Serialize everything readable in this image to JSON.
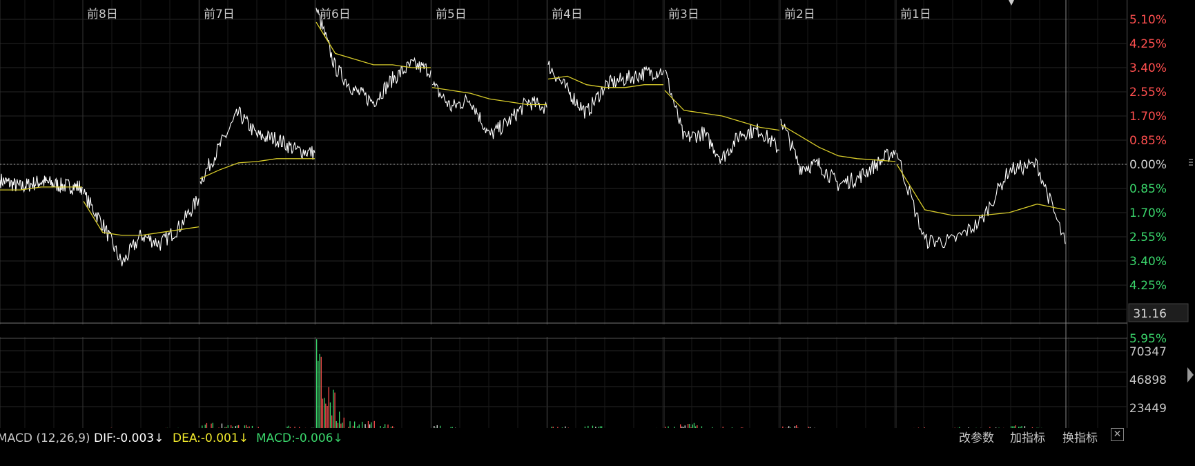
{
  "colors": {
    "background": "#000000",
    "grid": "#262626",
    "price_line": "#ffffff",
    "avg_line": "#d8cc2a",
    "up": "#ff4f4f",
    "down": "#3ad56b",
    "neutral": "#e6e6e6"
  },
  "chart_data": [
    {
      "type": "line",
      "unit": "percent change",
      "categories": [
        "前8日",
        "前7日",
        "前6日",
        "前5日",
        "前4日",
        "前3日",
        "前2日",
        "前1日"
      ],
      "y_axis_labels": [
        "5.95%",
        "5.10%",
        "4.25%",
        "3.40%",
        "2.55%",
        "1.70%",
        "0.85%",
        "0.00%",
        "0.85%",
        "1.70%",
        "2.55%",
        "3.40%",
        "4.25%"
      ],
      "ylim": [
        -4.9,
        5.95
      ],
      "grid": true,
      "current_value": "31.16",
      "bottom_cut_label": "5.95%",
      "series": [
        {
          "values": [
            [
              -0.55,
              -0.8,
              -0.6,
              -0.75,
              -0.8
            ],
            [
              -1.05,
              -2.1,
              -3.5,
              -2.5,
              -2.8,
              -2.2,
              -1.2
            ],
            [
              -0.6,
              0.6,
              1.8,
              1.0,
              0.9,
              0.5,
              0.4
            ],
            [
              5.5,
              3.4,
              2.6,
              2.2,
              3.0,
              3.5,
              3.3
            ],
            [
              2.8,
              2.0,
              2.3,
              1.0,
              1.5,
              2.2,
              2.0
            ],
            [
              3.5,
              2.6,
              1.8,
              2.8,
              3.0,
              3.2,
              3.3
            ],
            [
              3.3,
              0.9,
              1.1,
              0.2,
              1.1,
              1.2,
              0.5
            ],
            [
              1.6,
              -0.1,
              0.0,
              -0.7,
              -0.5,
              0.0,
              0.5
            ],
            [
              0.4,
              -2.7,
              -2.7,
              -2.0,
              -0.2,
              0.0,
              -2.8
            ]
          ]
        },
        {
          "values": [
            [
              -0.9,
              -0.9,
              -0.8,
              -0.8,
              -0.8
            ],
            [
              -1.3,
              -2.4,
              -2.5,
              -2.5,
              -2.4,
              -2.3,
              -2.2
            ],
            [
              -0.5,
              -0.2,
              0.05,
              0.1,
              0.2,
              0.2,
              0.2
            ],
            [
              5.0,
              3.9,
              3.7,
              3.5,
              3.5,
              3.4,
              3.4
            ],
            [
              2.7,
              2.6,
              2.5,
              2.3,
              2.2,
              2.1,
              2.1
            ],
            [
              3.0,
              3.1,
              2.8,
              2.7,
              2.7,
              2.8,
              2.8
            ],
            [
              2.6,
              1.9,
              1.8,
              1.7,
              1.5,
              1.3,
              1.2
            ],
            [
              1.4,
              1.0,
              0.6,
              0.3,
              0.2,
              0.15,
              0.1
            ],
            [
              0.0,
              -1.6,
              -1.8,
              -1.8,
              -1.7,
              -1.4,
              -1.6
            ]
          ]
        }
      ]
    },
    {
      "type": "bar",
      "y_axis_labels": [
        "70347",
        "46898",
        "23449"
      ],
      "ylim": [
        0,
        72000
      ],
      "series": [
        {
          "values": [
            [
              2100,
              1700,
              2000,
              1900,
              1600
            ],
            [
              3500,
              2200,
              4200,
              3000,
              3300,
              2100,
              4100,
              3100,
              3200
            ],
            [
              6800,
              7600,
              5400,
              6000,
              4100,
              3500,
              5300,
              4500,
              3600
            ],
            [
              70347,
              34700,
              10400,
              7500,
              8600,
              6700,
              3100,
              3200,
              2300
            ],
            [
              6300,
              5200,
              3100,
              3000,
              2800,
              2900,
              3300,
              2700,
              2200
            ],
            [
              4900,
              4600,
              6100,
              5300,
              4300,
              3100,
              2900,
              3100,
              3800
            ],
            [
              5200,
              6500,
              6900,
              3700,
              4500,
              4000,
              3600,
              2900,
              3300
            ],
            [
              5100,
              5500,
              4200,
              3700,
              2800,
              3100,
              2700,
              2900,
              3500
            ],
            [
              3700,
              3900,
              3300,
              4200,
              3600,
              4800,
              5300,
              3200,
              2900
            ]
          ]
        }
      ]
    }
  ],
  "macd": {
    "name": "MACD (12,26,9)",
    "dif": "DIF:-0.003↓",
    "dea": "DEA:-0.001↓",
    "macd": "MACD:-0.006↓"
  },
  "toolbar": {
    "modify_params": "改参数",
    "add_indicator": "加指标",
    "switch_indicator": "换指标",
    "close": "✕"
  }
}
